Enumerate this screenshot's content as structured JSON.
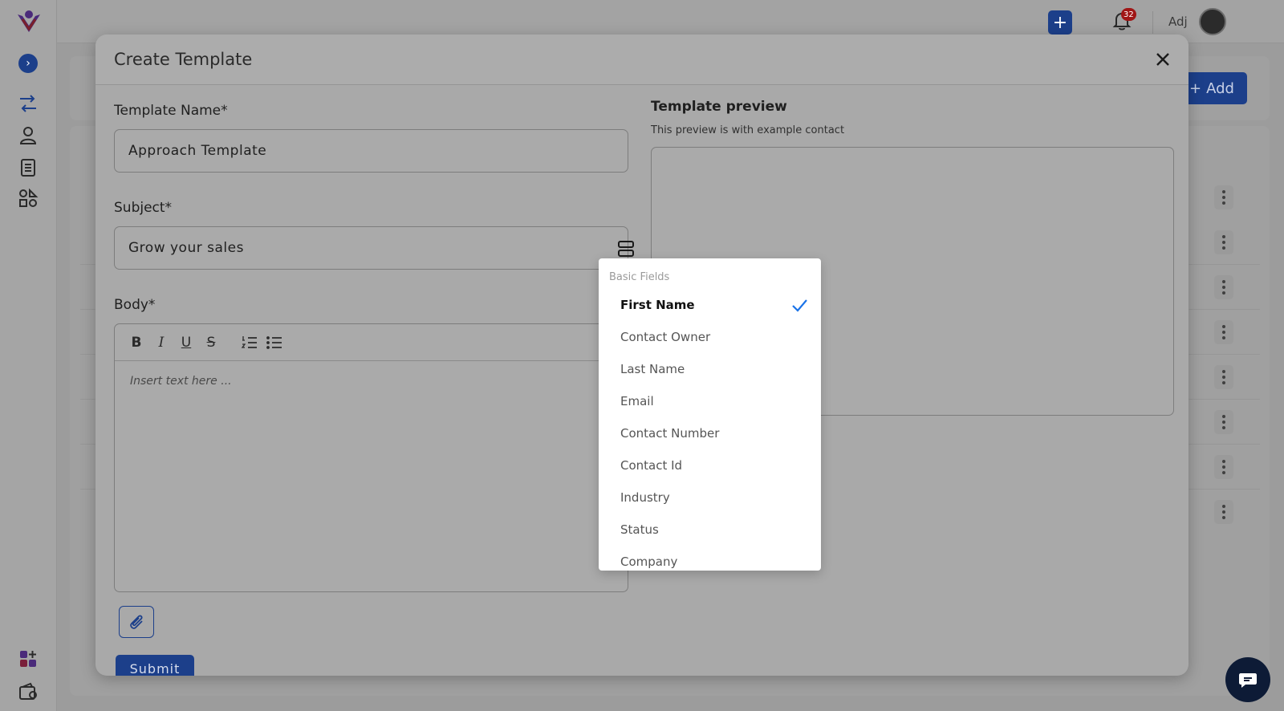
{
  "header": {
    "user_name": "Adj",
    "notification_count": "32"
  },
  "background": {
    "add_button_label": "Add"
  },
  "modal": {
    "title": "Create Template",
    "template_name_label": "Template Name*",
    "template_name_value": "Approach Template",
    "subject_label": "Subject*",
    "subject_value": "Grow your sales",
    "body_label": "Body*",
    "body_placeholder": "Insert text here ...",
    "submit_label": "Submit",
    "preview_title": "Template preview",
    "preview_subtitle": "This preview is with example contact"
  },
  "dropdown": {
    "group_label": "Basic Fields",
    "items": [
      {
        "label": "First Name",
        "selected": true
      },
      {
        "label": "Contact Owner",
        "selected": false
      },
      {
        "label": "Last Name",
        "selected": false
      },
      {
        "label": "Email",
        "selected": false
      },
      {
        "label": "Contact Number",
        "selected": false
      },
      {
        "label": "Contact Id",
        "selected": false
      },
      {
        "label": "Industry",
        "selected": false
      },
      {
        "label": "Status",
        "selected": false
      },
      {
        "label": "Company",
        "selected": false
      }
    ]
  },
  "colors": {
    "accent": "#1a73e8",
    "overlay_bg": "#9c9c9c",
    "badge": "#d32f2f"
  },
  "icons": [
    "app-logo-icon",
    "chevron-right-icon",
    "routes-icon",
    "user-icon",
    "clipboard-list-icon",
    "shapes-icon",
    "plus-icon",
    "bell-icon",
    "close-icon",
    "field-picker-icon",
    "bold-icon",
    "italic-icon",
    "underline-icon",
    "strikethrough-icon",
    "ordered-list-icon",
    "bullet-list-icon",
    "paperclip-icon",
    "check-icon",
    "apps-add-icon",
    "wallet-icon",
    "chat-icon",
    "more-vertical-icon"
  ]
}
